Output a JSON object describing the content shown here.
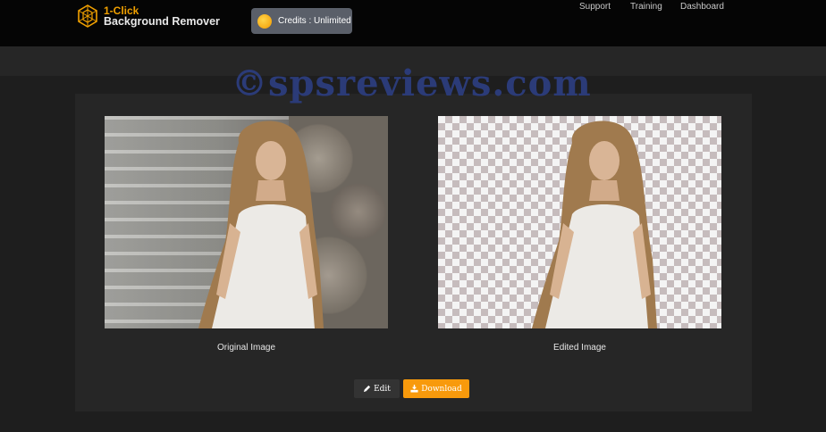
{
  "header": {
    "logo_line1": "1-Click",
    "logo_line2": "Background Remover",
    "credits_label": "Credits : Unlimited",
    "nav": [
      "Support",
      "Training",
      "Dashboard"
    ]
  },
  "watermark": "©spsreviews.com",
  "images": {
    "original_caption": "Original Image",
    "edited_caption": "Edited Image"
  },
  "actions": {
    "edit_label": "Edit",
    "download_label": "Download"
  },
  "colors": {
    "accent": "#f89a0c",
    "topbar": "#050505",
    "card": "#262626",
    "edit_button": "#333333",
    "credits_badge": "#5a5f69"
  },
  "icons": {
    "logo": "hexagon-network-icon",
    "credits": "coin-icon",
    "edit": "pencil-icon",
    "download": "download-icon"
  }
}
